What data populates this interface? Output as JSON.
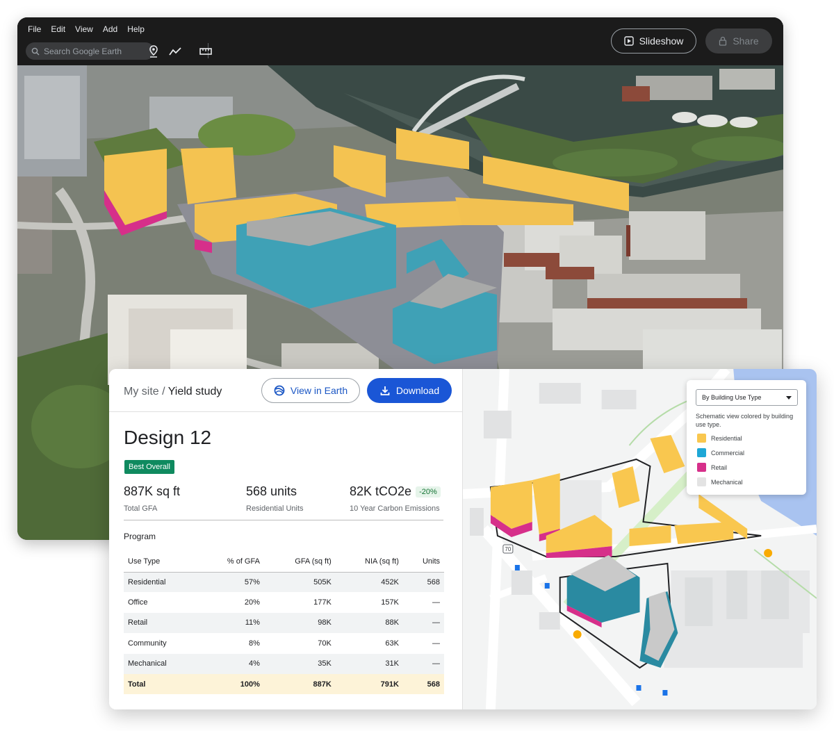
{
  "menu": [
    "File",
    "Edit",
    "View",
    "Add",
    "Help"
  ],
  "search": {
    "placeholder": "Search Google Earth"
  },
  "toolbar": {
    "slideshow_label": "Slideshow",
    "share_label": "Share"
  },
  "card": {
    "breadcrumb_root": "My site",
    "breadcrumb_sep": " / ",
    "breadcrumb_current": "Yield study",
    "view_in_earth_label": "View in Earth",
    "download_label": "Download",
    "design_title": "Design 12",
    "badge": "Best Overall",
    "metrics": [
      {
        "value": "887K sq ft",
        "label": "Total GFA"
      },
      {
        "value": "568 units",
        "label": "Residential Units"
      },
      {
        "value": "82K tCO2e",
        "badge": "-20%",
        "label": "10 Year Carbon Emissions"
      }
    ],
    "program_label": "Program",
    "table": {
      "headers": [
        "Use Type",
        "% of GFA",
        "GFA (sq ft)",
        "NIA (sq ft)",
        "Units"
      ],
      "rows": [
        [
          "Residential",
          "57%",
          "505K",
          "452K",
          "568"
        ],
        [
          "Office",
          "20%",
          "177K",
          "157K",
          "—"
        ],
        [
          "Retail",
          "11%",
          "98K",
          "88K",
          "—"
        ],
        [
          "Community",
          "8%",
          "70K",
          "63K",
          "—"
        ],
        [
          "Mechanical",
          "4%",
          "35K",
          "31K",
          "—"
        ]
      ],
      "total": [
        "Total",
        "100%",
        "887K",
        "791K",
        "568"
      ]
    }
  },
  "legend": {
    "select_value": "By Building Use Type",
    "description": "Schematic view colored by building use type.",
    "items": [
      {
        "label": "Residential",
        "color": "#f9c74f"
      },
      {
        "label": "Commercial",
        "color": "#1ea7d6"
      },
      {
        "label": "Retail",
        "color": "#d62f8a"
      },
      {
        "label": "Mechanical",
        "color": "#e3e3e3"
      }
    ]
  },
  "map": {
    "route_shield": "70"
  },
  "colors": {
    "residential": "#f9c74f",
    "commercial": "#1ea7d6",
    "retail": "#d62f8a",
    "accent_blue": "#1a56d6",
    "best_badge": "#0f8a5f"
  }
}
